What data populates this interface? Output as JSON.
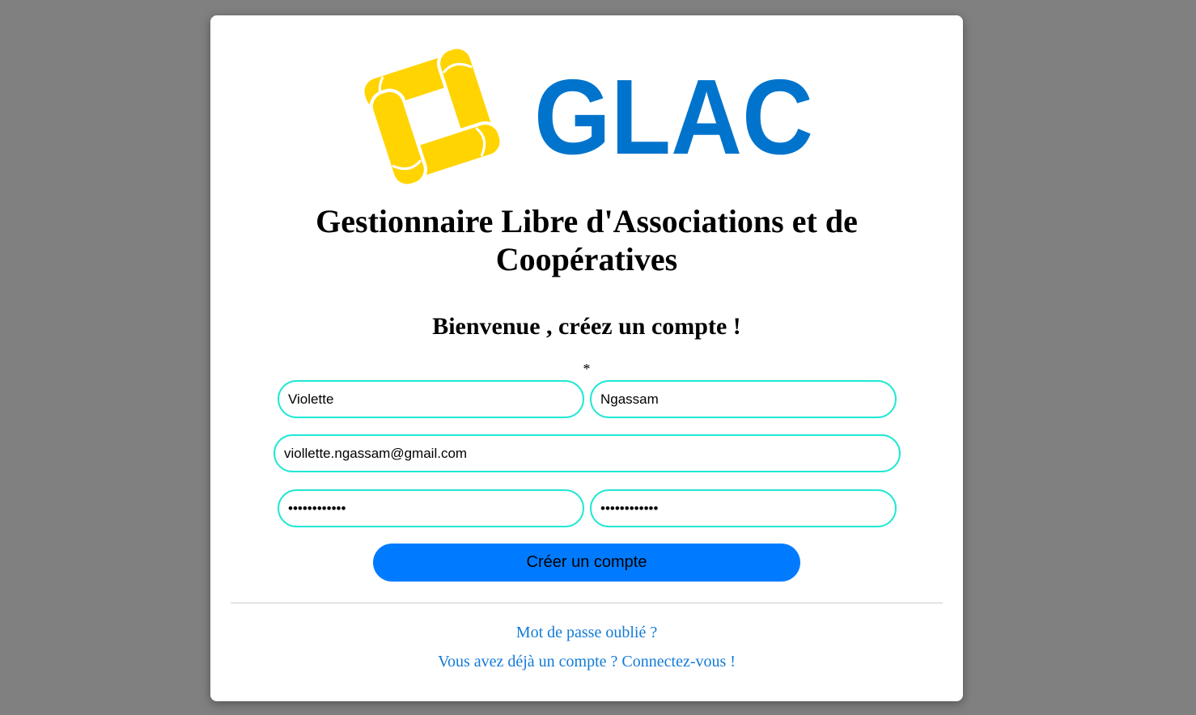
{
  "logo": {
    "wordmark": "GLAC",
    "emblem_icon": "hands-circle-icon"
  },
  "header": {
    "title": "Gestionnaire Libre d'Associations et de Coopératives",
    "subtitle": "Bienvenue , créez un compte !"
  },
  "form": {
    "required_marker": "*",
    "first_name": {
      "value": "Violette"
    },
    "last_name": {
      "value": "Ngassam"
    },
    "email": {
      "value": "viollette.ngassam@gmail.com"
    },
    "password": {
      "value": "••••••••••••"
    },
    "password_confirm": {
      "value": "••••••••••••"
    },
    "submit_label": "Créer un compte"
  },
  "links": {
    "forgot_password": "Mot de passe oublié ?",
    "login": "Vous avez déjà un compte ? Connectez-vous !"
  },
  "colors": {
    "emblem": "#FFD400",
    "wordmark": "#0074CC",
    "button": "#007bff",
    "input_border": "#1fe8d4",
    "link": "#127bd7",
    "page_background": "#808080"
  }
}
